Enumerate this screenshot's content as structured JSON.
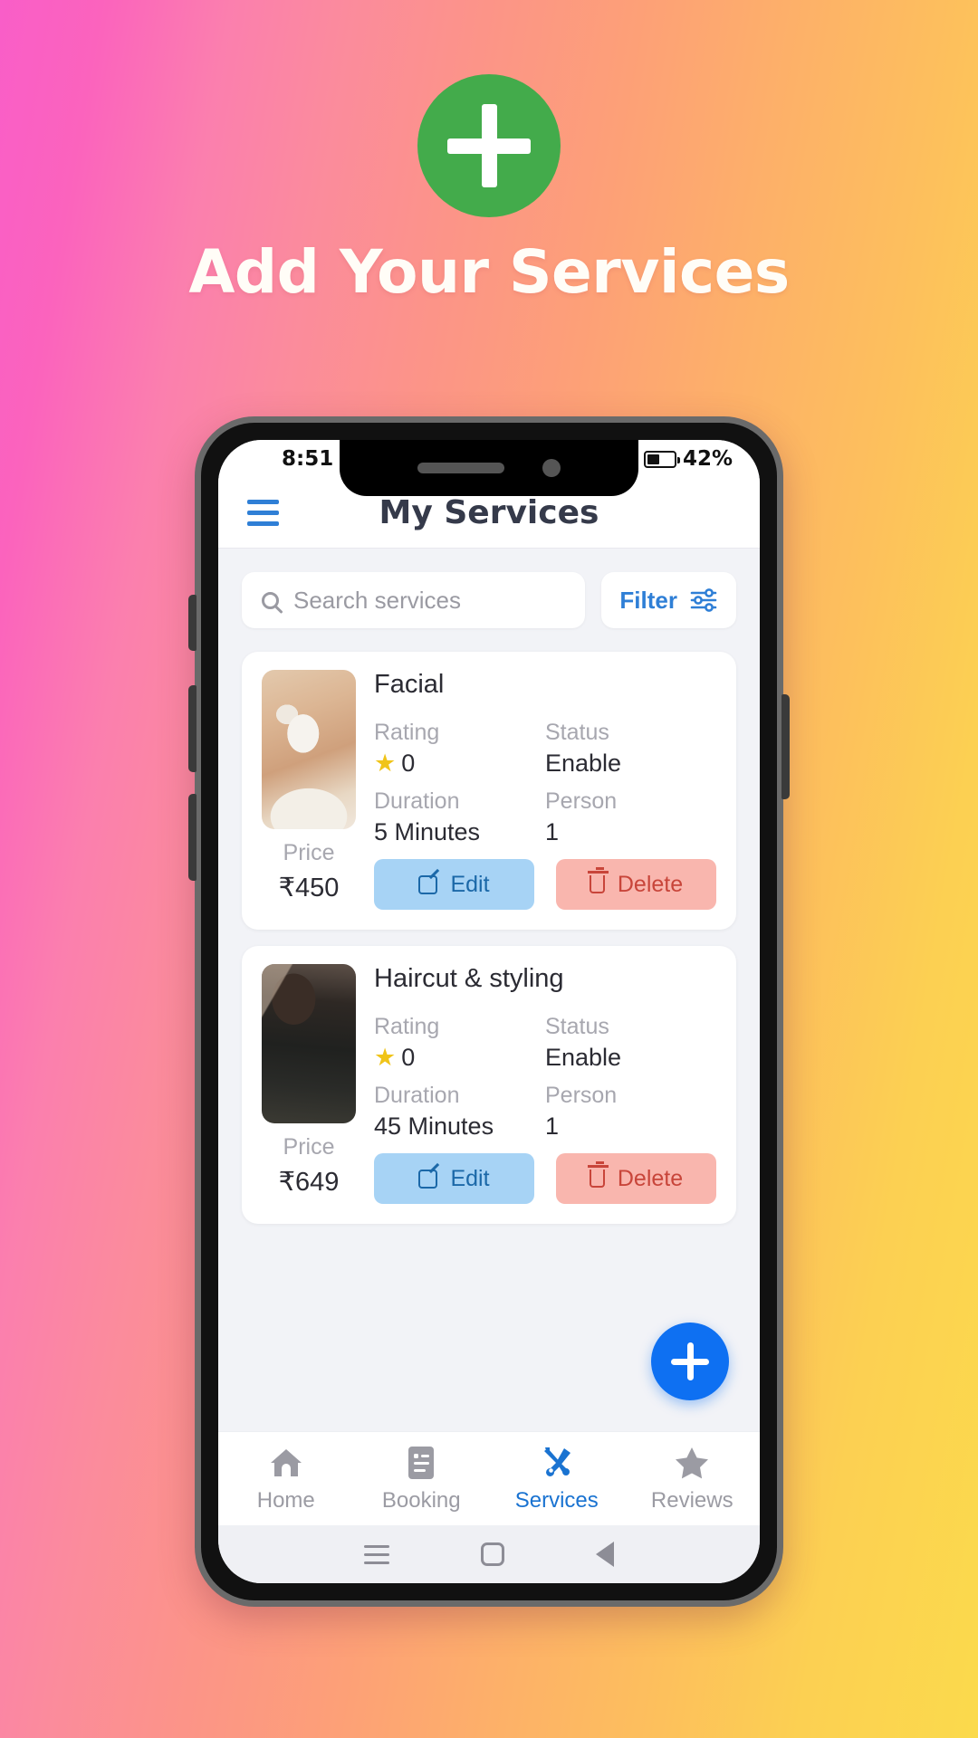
{
  "promo": {
    "badge_icon": "plus-icon",
    "badge_color": "#43ab4b",
    "title": "Add Your Services"
  },
  "status_bar": {
    "time": "8:51",
    "battery_percent": "42%",
    "battery_level": 42
  },
  "app_bar": {
    "menu_icon": "hamburger-menu-icon",
    "title": "My Services"
  },
  "search": {
    "icon": "search-icon",
    "placeholder": "Search services",
    "value": ""
  },
  "filter": {
    "label": "Filter",
    "icon": "tune-sliders-icon"
  },
  "labels": {
    "rating": "Rating",
    "status": "Status",
    "duration": "Duration",
    "person": "Person",
    "price": "Price",
    "edit": "Edit",
    "delete": "Delete",
    "star": "★"
  },
  "services": [
    {
      "name": "Facial",
      "rating": "0",
      "status": "Enable",
      "duration": "5 Minutes",
      "person": "1",
      "price": "₹450",
      "thumb": "facial-photo"
    },
    {
      "name": "Haircut & styling",
      "rating": "0",
      "status": "Enable",
      "duration": "45 Minutes",
      "person": "1",
      "price": "₹649",
      "thumb": "haircut-photo"
    }
  ],
  "fab": {
    "icon": "plus-icon",
    "color": "#0e70f2"
  },
  "bottom_nav": {
    "active_color": "#1a73d1",
    "items": [
      {
        "label": "Home",
        "icon": "home-icon",
        "active": false
      },
      {
        "label": "Booking",
        "icon": "document-icon",
        "active": false
      },
      {
        "label": "Services",
        "icon": "tools-icon",
        "active": true
      },
      {
        "label": "Reviews",
        "icon": "star-icon",
        "active": false
      }
    ]
  },
  "android_nav": {
    "recents_icon": "recents-icon",
    "home_icon": "home-square-icon",
    "back_icon": "back-triangle-icon"
  }
}
